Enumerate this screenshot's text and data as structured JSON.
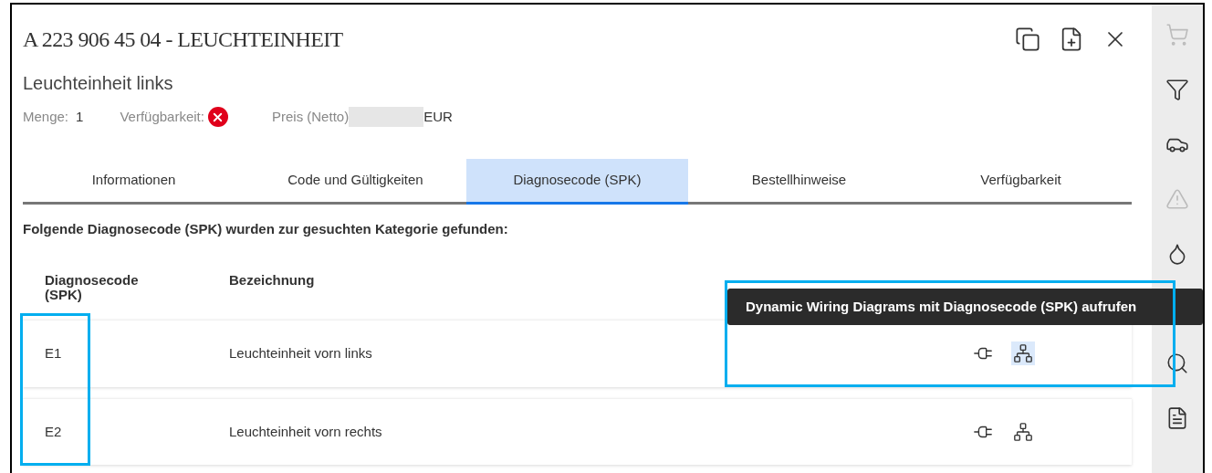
{
  "dialog": {
    "title": "A 223 906 45 04 - LEUCHTEINHEIT",
    "subtitle": "Leuchteinheit links",
    "quantity_label": "Menge:",
    "quantity": "1",
    "availability_label": "Verfügbarkeit:",
    "available": false,
    "price_label": "Preis (Netto)",
    "currency": "EUR"
  },
  "tabs": [
    {
      "label": "Informationen",
      "selected": false
    },
    {
      "label": "Code und Gültigkeiten",
      "selected": false
    },
    {
      "label": "Diagnosecode (SPK)",
      "selected": true
    },
    {
      "label": "Bestellhinweise",
      "selected": false
    },
    {
      "label": "Verfügbarkeit",
      "selected": false
    }
  ],
  "section_heading": "Folgende Diagnosecode (SPK) wurden zur gesuchten Kategorie gefunden:",
  "table": {
    "columns": [
      "Diagnosecode (SPK)",
      "Bezeichnung"
    ],
    "rows": [
      {
        "code": "E1",
        "description": "Leuchteinheit vorn links",
        "wiring_hovered": true
      },
      {
        "code": "E2",
        "description": "Leuchteinheit vorn rechts",
        "wiring_hovered": false
      }
    ]
  },
  "tooltip": "Dynamic Wiring Diagrams mit Diagnosecode (SPK) aufrufen",
  "sidebar": [
    {
      "kind": "cart",
      "disabled": true
    },
    {
      "kind": "filter",
      "disabled": false
    },
    {
      "kind": "car",
      "disabled": false
    },
    {
      "kind": "warning",
      "disabled": true
    },
    {
      "kind": "oil",
      "disabled": false
    },
    {
      "kind": "search",
      "disabled": false
    },
    {
      "kind": "wis",
      "disabled": false
    }
  ]
}
